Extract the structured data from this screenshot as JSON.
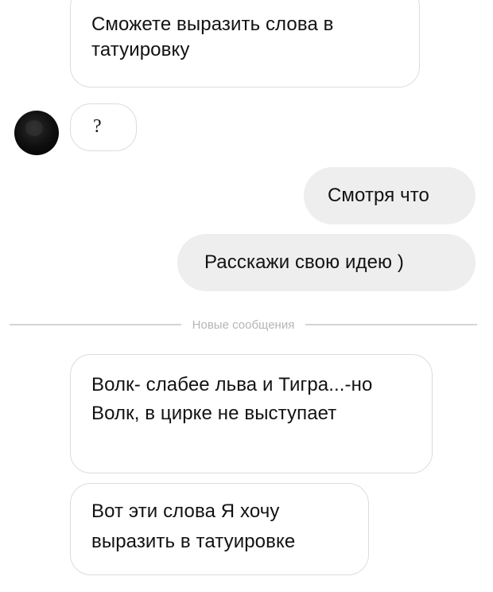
{
  "messages": {
    "m1": "Сможете выразить слова в татуировку",
    "m2": "?",
    "m3": "Смотря что",
    "m4": "Расскажи свою идею )",
    "m5": "Волк- слабее льва и Тигра...-но Волк, в цирке не выступает",
    "m6": "Вот эти слова Я хочу выразить в татуировке"
  },
  "divider": {
    "label": "Новые сообщения"
  }
}
